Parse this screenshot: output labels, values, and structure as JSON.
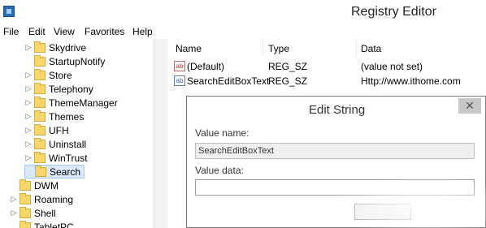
{
  "window": {
    "title": "Registry Editor"
  },
  "menu": [
    "File",
    "Edit",
    "View",
    "Favorites",
    "Help"
  ],
  "tree": [
    {
      "label": "Skydrive",
      "expander": "▷"
    },
    {
      "label": "StartupNotify",
      "expander": ""
    },
    {
      "label": "Store",
      "expander": "▷"
    },
    {
      "label": "Telephony",
      "expander": "▷"
    },
    {
      "label": "ThemeManager",
      "expander": "▷"
    },
    {
      "label": "Themes",
      "expander": "▷"
    },
    {
      "label": "UFH",
      "expander": "▷"
    },
    {
      "label": "Uninstall",
      "expander": "▷"
    },
    {
      "label": "WinTrust",
      "expander": "▷"
    },
    {
      "label": "Search",
      "expander": ""
    },
    {
      "label": "DWM",
      "expander": ""
    },
    {
      "label": "Roaming",
      "expander": "▷"
    },
    {
      "label": "Shell",
      "expander": "▷"
    },
    {
      "label": "TabletPC",
      "expander": ""
    }
  ],
  "columns": {
    "name": "Name",
    "type": "Type",
    "data": "Data"
  },
  "values": [
    {
      "icon": "ab",
      "name": "(Default)",
      "type": "REG_SZ",
      "data": "(value not set)"
    },
    {
      "icon": "ab",
      "name": "SearchEditBoxText",
      "type": "REG_SZ",
      "data": "Http://www.ithome.com"
    }
  ],
  "dialog": {
    "title": "Edit String",
    "close": "✕",
    "value_name_label": "Value name:",
    "value_name": "SearchEditBoxText",
    "value_data_label": "Value data:",
    "value_data": ""
  }
}
